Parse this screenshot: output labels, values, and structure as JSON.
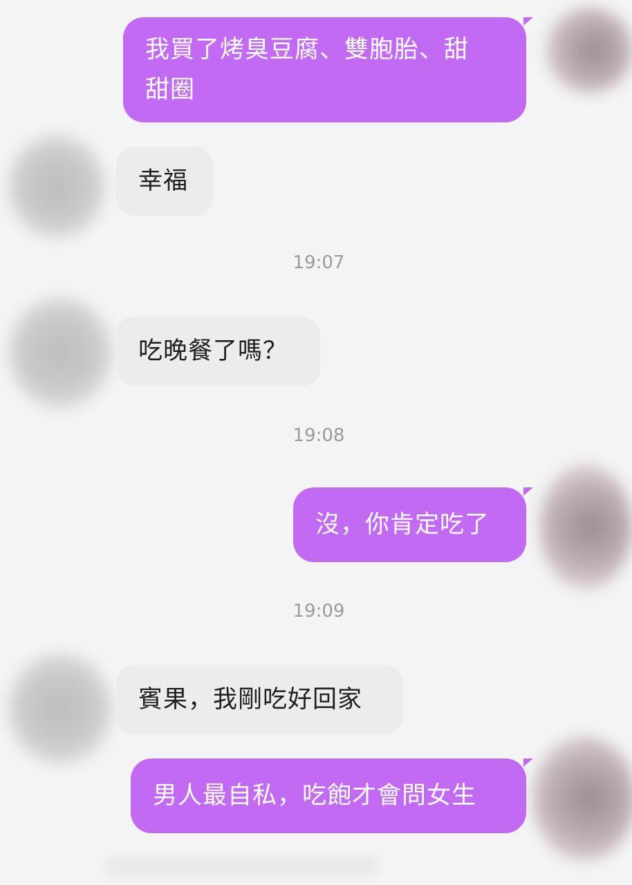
{
  "messages": {
    "m1": "我買了烤臭豆腐、雙胞胎、甜甜圈",
    "m1_line1": "我買了烤臭豆腐、雙胞胎、甜",
    "m1_line2": "甜圈",
    "m2": "幸福",
    "t1": "19:07",
    "m3": "吃晚餐了嗎？",
    "t2": "19:08",
    "m4": "沒，你肯定吃了",
    "t3": "19:09",
    "m5": "賓果，我剛吃好回家",
    "m6": "男人最自私，吃飽才會問女生"
  },
  "colors": {
    "self_bubble": "#c36af5",
    "other_bubble": "#ececec",
    "background": "#f4f4f4",
    "timestamp": "#9a9a9a"
  }
}
